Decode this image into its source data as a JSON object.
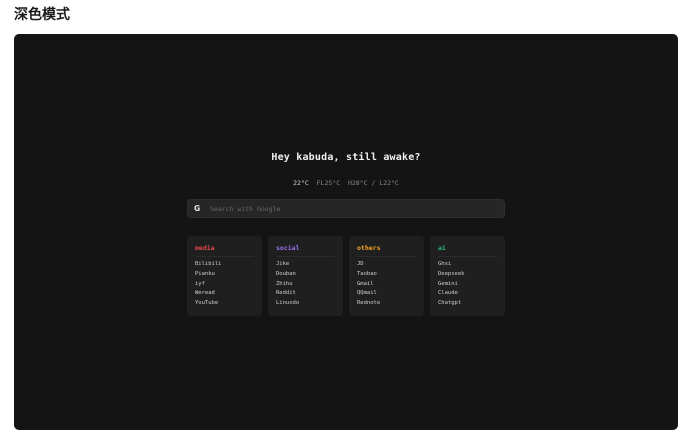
{
  "page": {
    "heading": "深色模式"
  },
  "greeting": "Hey kabuda, still awake?",
  "weather": {
    "temp": "22°C",
    "feels_like": "FL25°C",
    "high": "H28°C",
    "separator": "/",
    "low": "L22°C"
  },
  "search": {
    "icon": "google-g-icon",
    "icon_glyph": "G",
    "placeholder": "Search with Google",
    "value": ""
  },
  "categories": [
    {
      "title": "media",
      "color": "#e5484d",
      "links": [
        "Bilibili",
        "Pianku",
        "iyf",
        "Weread",
        "YouTube"
      ]
    },
    {
      "title": "social",
      "color": "#9b72f2",
      "links": [
        "Jike",
        "Douban",
        "Zhihu",
        "Reddit",
        "Linuxdo"
      ]
    },
    {
      "title": "others",
      "color": "#f5a524",
      "links": [
        "JD",
        "Taobao",
        "Gmail",
        "QQmail",
        "Rednote"
      ]
    },
    {
      "title": "ai",
      "color": "#2bbf7a",
      "links": [
        "Ghxi",
        "Deepseek",
        "Gemini",
        "Claude",
        "Chatgpt"
      ]
    }
  ],
  "colors": {
    "background": "#141414",
    "card": "#1f1f1f",
    "search": "#262626",
    "text": "#f2f2f2"
  }
}
